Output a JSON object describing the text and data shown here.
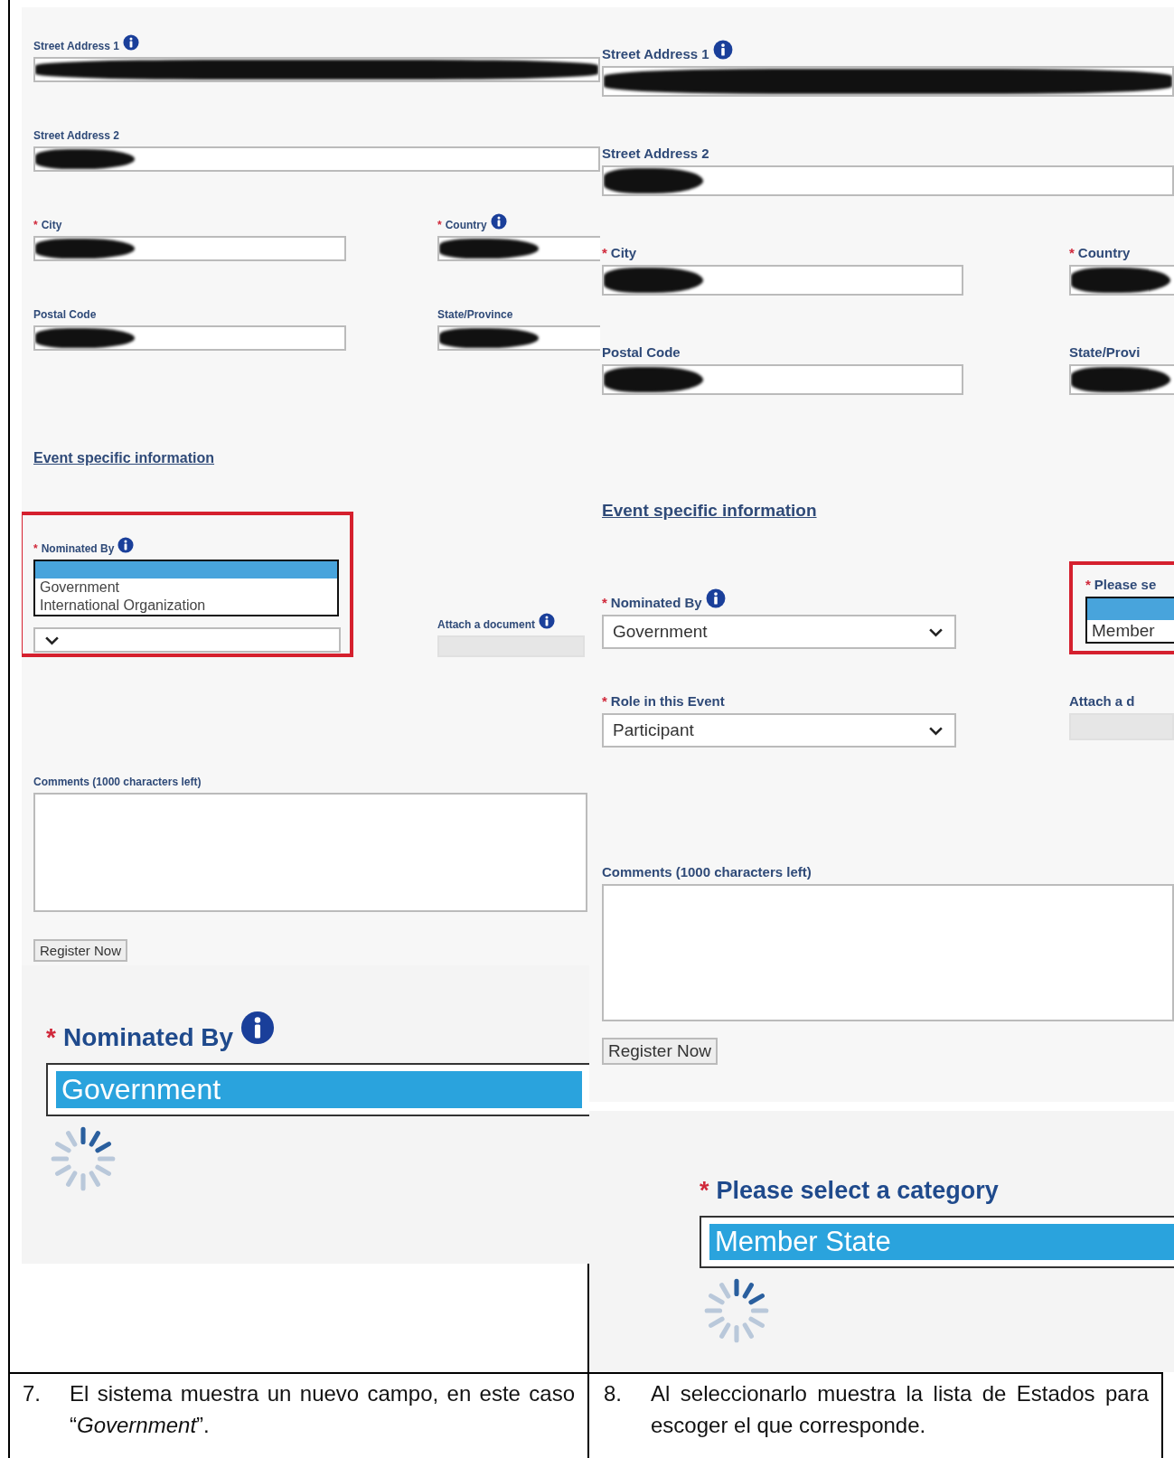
{
  "panels": [
    {
      "rows": [
        {
          "kind": "fields",
          "fields": [
            {
              "kind": "text",
              "label": "Street Address 1",
              "info": true,
              "redacted": true
            }
          ]
        },
        {
          "kind": "fields",
          "fields": [
            {
              "kind": "text",
              "label": "Street Address 2",
              "info": false,
              "redacted": true
            }
          ]
        },
        {
          "kind": "fields",
          "fields": [
            {
              "kind": "text",
              "label": "City",
              "marker": "*",
              "info": false,
              "redacted": true
            },
            {
              "kind": "text",
              "label": "Country",
              "marker": "*",
              "info": true,
              "redacted": true
            }
          ]
        },
        {
          "kind": "fields",
          "fields": [
            {
              "kind": "text",
              "label": "Postal Code",
              "info": false,
              "redacted": true
            },
            {
              "kind": "text",
              "label": "State/Province",
              "info": false,
              "redacted": true
            }
          ]
        },
        {
          "kind": "link",
          "text": "Event specific information"
        },
        {
          "kind": "fields",
          "fields": [
            {
              "kind": "listbox_over_select",
              "label": "Nominated By",
              "marker": "*",
              "info": true,
              "options": [
                {
                  "selected": true
                },
                {
                  "label": "Government",
                  "selected": false
                },
                {
                  "label": "International Organization",
                  "selected": false
                }
              ]
            },
            {
              "kind": "file",
              "label": "Attach a document",
              "info": true
            }
          ]
        },
        {
          "kind": "fields",
          "fields": [
            {
              "kind": "textarea",
              "label": "Comments (1000 characters left)",
              "info": false
            }
          ]
        },
        {
          "kind": "button",
          "label": "Register Now"
        }
      ],
      "inset": {
        "label": "Nominated By",
        "marker": "*",
        "info": true,
        "value": "Government"
      }
    },
    {
      "rows": [
        {
          "kind": "fields",
          "fields": [
            {
              "kind": "text",
              "label": "Street Address 1",
              "info": true,
              "redacted": true
            }
          ]
        },
        {
          "kind": "fields",
          "fields": [
            {
              "kind": "text",
              "label": "Street Address 2",
              "info": false,
              "redacted": true
            }
          ]
        },
        {
          "kind": "fields",
          "fields": [
            {
              "kind": "text",
              "label": "City",
              "marker": "*",
              "info": false,
              "redacted": true
            },
            {
              "kind": "text",
              "label": "Country",
              "marker": "*",
              "info": false,
              "redacted": true
            }
          ]
        },
        {
          "kind": "fields",
          "fields": [
            {
              "kind": "text",
              "label": "Postal Code",
              "info": false,
              "redacted": true
            },
            {
              "kind": "text",
              "label": "State/Provi",
              "info": false,
              "redacted": true
            }
          ]
        },
        {
          "kind": "link",
          "text": "Event specific information"
        },
        {
          "kind": "fields",
          "fields": [
            {
              "kind": "select",
              "label": "Nominated By",
              "marker": "*",
              "info": true,
              "value": "Government"
            },
            {
              "kind": "listbox",
              "label": "Please se",
              "marker": "*",
              "info": false,
              "options": [
                {
                  "selected": true
                },
                {
                  "label": "Member",
                  "selected": false
                }
              ]
            }
          ]
        },
        {
          "kind": "fields",
          "fields": [
            {
              "kind": "select",
              "label": "Role in this Event",
              "marker": "*",
              "info": false,
              "value": "Participant"
            },
            {
              "kind": "file",
              "label": "Attach a d",
              "info": false
            }
          ]
        },
        {
          "kind": "fields",
          "fields": [
            {
              "kind": "textarea",
              "label": "Comments (1000 characters left)",
              "info": false
            }
          ]
        },
        {
          "kind": "button",
          "label": "Register Now"
        }
      ],
      "inset": {
        "label": "Please select a category",
        "marker": "*",
        "info": false,
        "value": "Member State"
      }
    }
  ],
  "captions": [
    {
      "number": "7.",
      "text": "El sistema muestra un nuevo campo, en este caso “*Government*”."
    },
    {
      "number": "8.",
      "text": "Al seleccionarlo muestra la lista de Estados para escoger el que corresponde."
    }
  ]
}
